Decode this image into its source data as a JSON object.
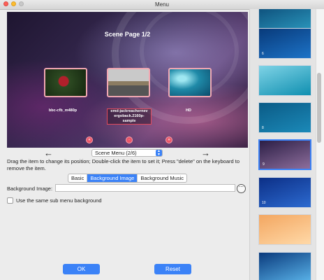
{
  "window": {
    "title": "Menu"
  },
  "preview": {
    "scene_title": "Scene Page  1/2",
    "items": [
      {
        "label": "bbc-cfb_m480p"
      },
      {
        "label": "emd-jackreachernev ergoback.2160p-sample"
      },
      {
        "label": "HD"
      }
    ],
    "nav_icons": [
      "«",
      "·",
      "»"
    ]
  },
  "navigation": {
    "prev_icon": "←",
    "next_icon": "→",
    "scene_menu_value": "Scene Menu (2/6)"
  },
  "instructions": "Drag the item to change its position; Double-click the item to set it; Press \"delete\" on the keyboard to remove the item.",
  "tabs": [
    {
      "label": "Basic",
      "active": false
    },
    {
      "label": "Background Image",
      "active": true
    },
    {
      "label": "Background Music",
      "active": false
    }
  ],
  "background_image": {
    "label": "Background Image:",
    "value": "",
    "more_icon": "⋯"
  },
  "checkbox": {
    "label": "Use the same sub menu background",
    "checked": false
  },
  "buttons": {
    "ok": "OK",
    "reset": "Reset"
  },
  "templates": [
    {
      "number": "",
      "colors": [
        "#0d4e7a",
        "#2e9fc4"
      ]
    },
    {
      "number": "6",
      "colors": [
        "#083a7a",
        "#1d73c7"
      ]
    },
    {
      "number": "",
      "colors": [
        "#7fd3e6",
        "#0f8fb0"
      ]
    },
    {
      "number": "8",
      "colors": [
        "#0b5b86",
        "#1b89b8"
      ]
    },
    {
      "number": "9",
      "colors": [
        "#2b1e45",
        "#8e6e9c"
      ],
      "selected": true
    },
    {
      "number": "10",
      "colors": [
        "#0c2f86",
        "#2c6ad0"
      ]
    },
    {
      "number": "",
      "colors": [
        "#f3a660",
        "#ffd9a8"
      ]
    },
    {
      "number": "",
      "colors": [
        "#0a3a7c",
        "#5ab4ea"
      ]
    }
  ],
  "colors": {
    "accent": "#3b82f7",
    "thumb_border": "#f2a8b2",
    "nav_dot": "#e9576a"
  }
}
